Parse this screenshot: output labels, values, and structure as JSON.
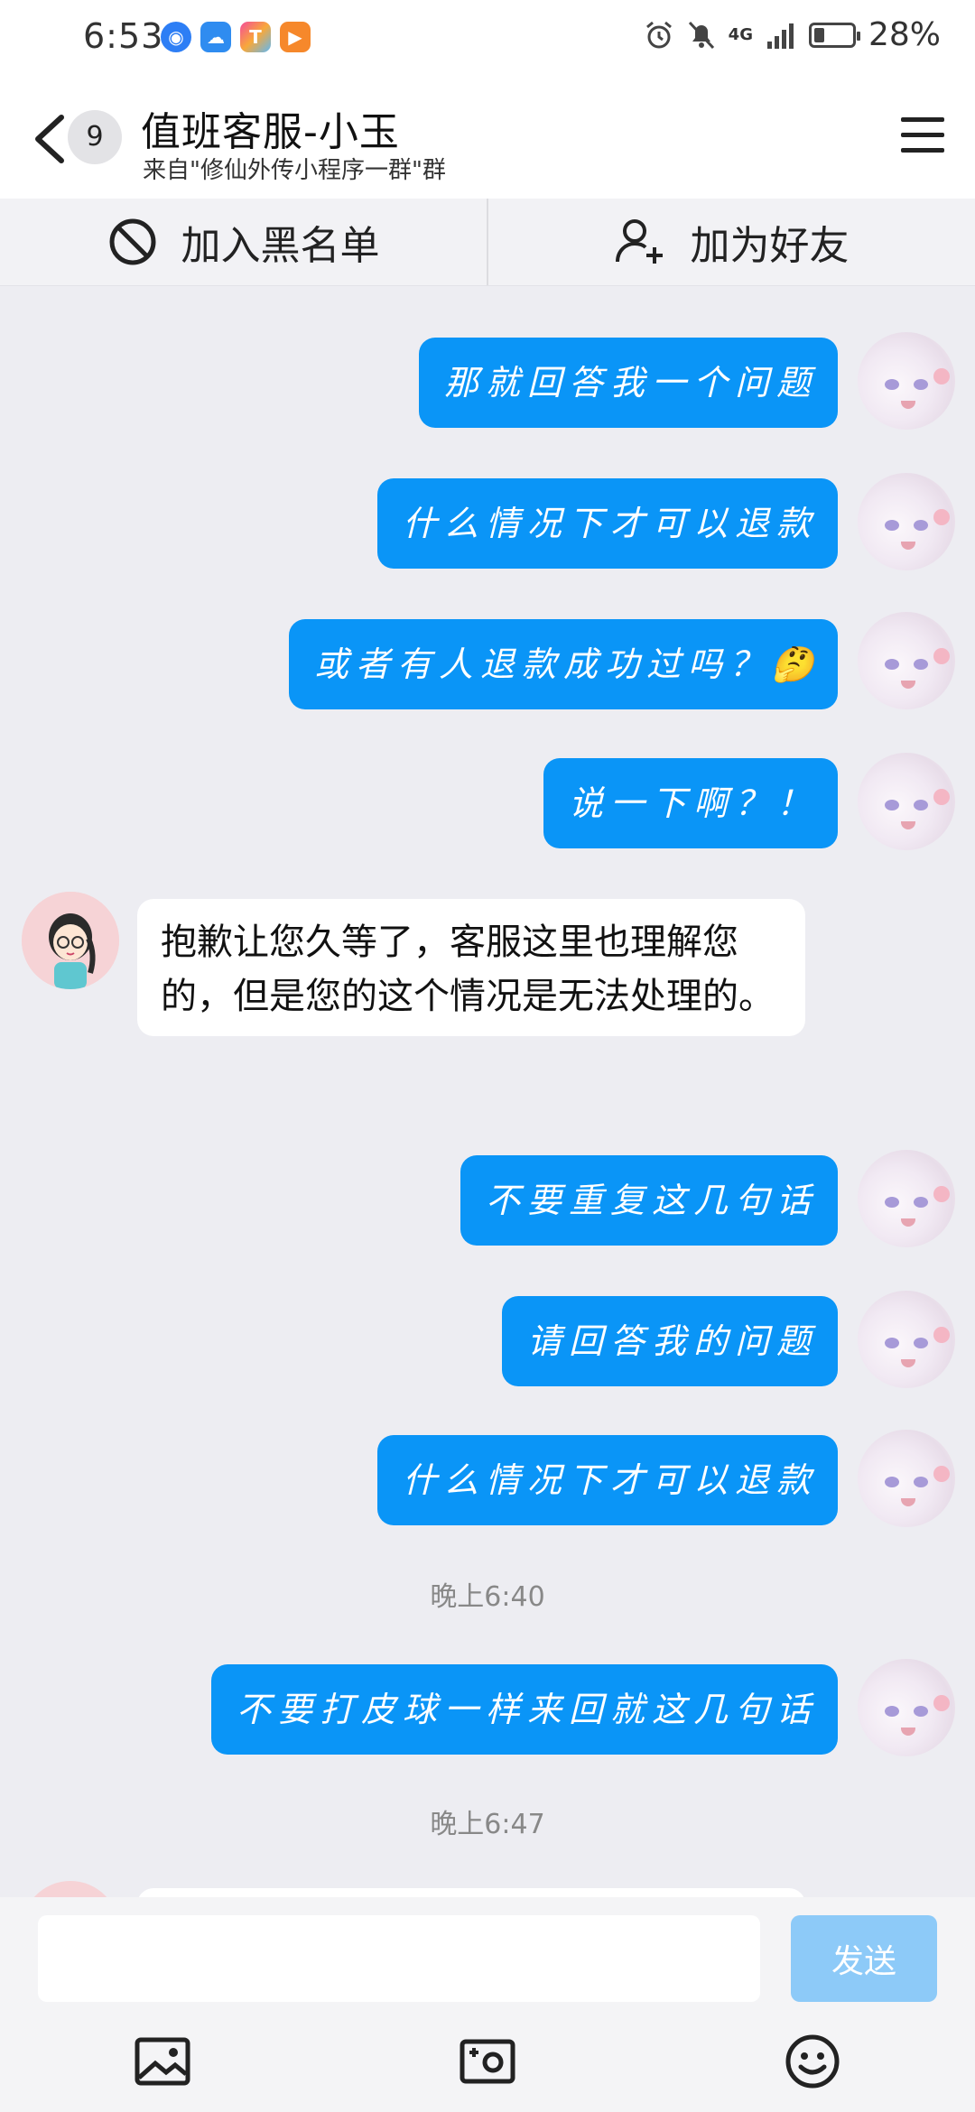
{
  "status_bar": {
    "time": "6:53",
    "network": "4G",
    "battery": "28%",
    "battery_level": 0.28
  },
  "header": {
    "back_count": "9",
    "title": "值班客服-小玉",
    "subtitle": "来自\"修仙外传小程序一群\"群"
  },
  "actions": {
    "blacklist": "加入黑名单",
    "add_friend": "加为好友"
  },
  "messages": [
    {
      "from": "me",
      "text": "那就回答我一个问题"
    },
    {
      "from": "me",
      "text": "什么情况下才可以退款"
    },
    {
      "from": "me",
      "text": "或者有人退款成功过吗？🤔"
    },
    {
      "from": "me",
      "text": "说一下啊？！"
    },
    {
      "from": "agent",
      "text": "抱歉让您久等了，客服这里也理解您的，但是您的这个情况是无法处理的。"
    },
    {
      "from": "me",
      "text": "不要重复这几句话"
    },
    {
      "from": "me",
      "text": "请回答我的问题"
    },
    {
      "from": "me",
      "text": "什么情况下才可以退款"
    },
    {
      "from": "time",
      "text": "晚上6:40"
    },
    {
      "from": "me",
      "text": "不要打皮球一样来回就这几句话"
    },
    {
      "from": "time",
      "text": "晚上6:47"
    }
  ],
  "input": {
    "placeholder": "",
    "send_label": "发送"
  },
  "toolbar": [
    "image-icon",
    "camera-icon",
    "emoji-icon"
  ]
}
